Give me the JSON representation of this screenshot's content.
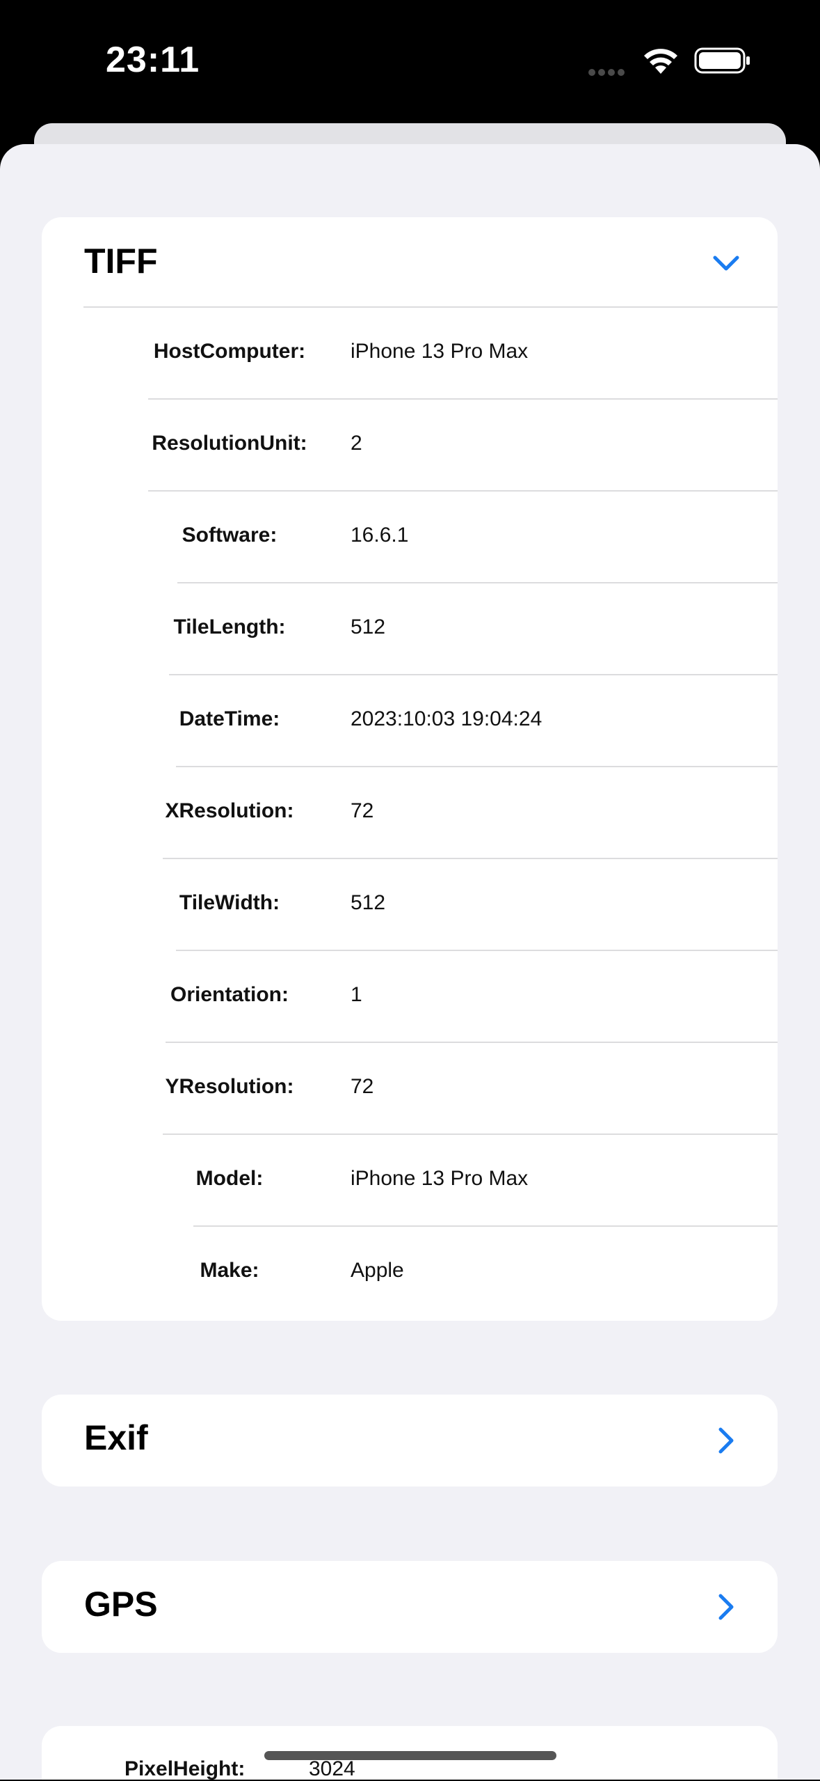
{
  "status_bar": {
    "time": "23:11",
    "icons": [
      "cellular-dots-icon",
      "wifi-icon",
      "battery-icon"
    ]
  },
  "sections": {
    "tiff": {
      "title": "TIFF",
      "expanded": true,
      "rows": [
        {
          "label": "HostComputer:",
          "value": "iPhone 13 Pro Max"
        },
        {
          "label": "ResolutionUnit:",
          "value": "2"
        },
        {
          "label": "Software:",
          "value": "16.6.1"
        },
        {
          "label": "TileLength:",
          "value": "512"
        },
        {
          "label": "DateTime:",
          "value": "2023:10:03 19:04:24"
        },
        {
          "label": "XResolution:",
          "value": "72"
        },
        {
          "label": "TileWidth:",
          "value": "512"
        },
        {
          "label": "Orientation:",
          "value": "1"
        },
        {
          "label": "YResolution:",
          "value": "72"
        },
        {
          "label": "Model:",
          "value": "iPhone 13 Pro Max"
        },
        {
          "label": "Make:",
          "value": "Apple"
        }
      ]
    },
    "exif": {
      "title": "Exif",
      "expanded": false
    },
    "gps": {
      "title": "GPS",
      "expanded": false
    },
    "image": {
      "rows": [
        {
          "label": "PixelHeight:",
          "value": "3024"
        }
      ]
    }
  },
  "colors": {
    "accent": "#1a7cf0",
    "background": "#f1f1f6",
    "card": "#ffffff",
    "separator": "#dcdcde"
  }
}
